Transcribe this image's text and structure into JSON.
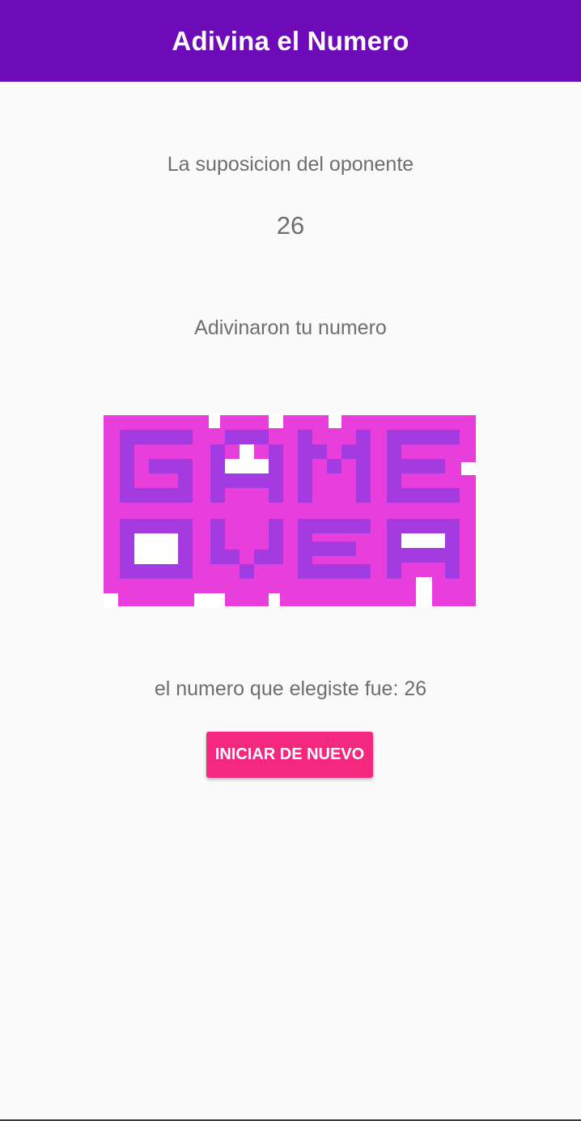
{
  "app_bar": {
    "title": "Adivina el Numero",
    "color": "#6c0bb7"
  },
  "game": {
    "opponent_label": "La suposicion del oponente",
    "opponent_guess": "26",
    "result_message": "Adivinaron tu numero",
    "image": {
      "icon": "game-over-pixel-art-icon",
      "text": "GAME OVER",
      "colors": {
        "outline": "#e83fdc",
        "letters": "#a33be0",
        "background": "#ffffff"
      }
    },
    "chosen_number_label": "el numero que elegiste fue: ",
    "chosen_number": "26",
    "restart_button": "INICIAR DE NUEVO",
    "button_color": "#f5287f"
  }
}
